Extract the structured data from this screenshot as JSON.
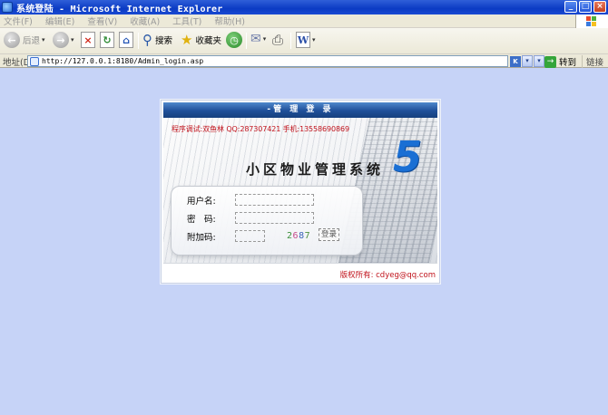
{
  "window": {
    "title": "系统登陆 - Microsoft Internet Explorer",
    "minimize_symbol": "_",
    "maximize_symbol": "□",
    "close_symbol": "×"
  },
  "menu": {
    "items": [
      "文件(F)",
      "编辑(E)",
      "查看(V)",
      "收藏(A)",
      "工具(T)",
      "帮助(H)"
    ]
  },
  "toolbar": {
    "back_label": "后退",
    "search_label": "搜索",
    "favorites_label": "收藏夹",
    "back_icon": "←",
    "forward_icon": "→",
    "stop_icon": "×",
    "refresh_icon": "↻",
    "home_icon": "⌂",
    "search_icon": "⚲",
    "favorites_icon": "★",
    "history_icon": "◷",
    "mail_icon": "✉",
    "print_icon": "⎙",
    "word_icon": "W",
    "dropdown_glyph": "▾"
  },
  "address": {
    "label": "地址(D)",
    "url": "http://127.0.0.1:8180/Admin_login.asp",
    "go_label": "转到",
    "go_icon": "→",
    "links_label": "链接",
    "k_icon": "K",
    "dd_icon": "▾"
  },
  "login": {
    "header": "-管 理 登 录",
    "credit": "程序调试:双鱼林 QQ:287307421 手机:13558690869",
    "system_title": "小区物业管理系统",
    "big_number": "5",
    "username_label": "用户名:",
    "password_label": "密　码:",
    "captcha_label": "附加码:",
    "captcha_chars": [
      "2",
      "6",
      "8",
      "7"
    ],
    "login_button": "登录",
    "copyright": "版权所有: cdyeg@qq.com"
  },
  "colors": {
    "page_bg": "#c6d3f7",
    "title_blue": "#0b3bc4",
    "credit_red": "#c0121b",
    "five_blue": "#1a6fd4"
  }
}
